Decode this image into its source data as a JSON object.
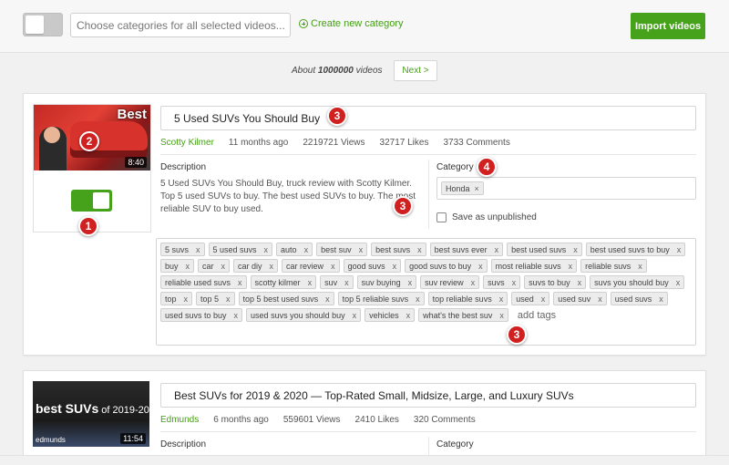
{
  "topbar": {
    "categories_placeholder": "Choose categories for all selected videos...",
    "create_category_label": "Create new category",
    "import_label": "Import videos"
  },
  "pagination": {
    "about_prefix": "About",
    "count": "1000000",
    "about_suffix": "videos",
    "next_label": "Next >"
  },
  "videos": [
    {
      "title": "5 Used SUVs You Should Buy",
      "channel": "Scotty Kilmer",
      "age": "11 months ago",
      "views": "2219721 Views",
      "likes": "32717 Likes",
      "comments": "3733 Comments",
      "thumb_text": "Best",
      "duration": "8:40",
      "description_label": "Description",
      "description": "5 Used SUVs You Should Buy, truck review with Scotty Kilmer. Top 5 used SUVs to buy. The best used SUVs to buy. The most reliable SUV to buy used.",
      "category_label": "Category",
      "category_chip": "Honda",
      "unpublished_label": "Save as unpublished",
      "add_tags_label": "add tags",
      "tags": [
        "5 suvs",
        "5 used suvs",
        "auto",
        "best suv",
        "best suvs",
        "best suvs ever",
        "best used suvs",
        "best used suvs to buy",
        "buy",
        "car",
        "car diy",
        "car review",
        "good suvs",
        "good suvs to buy",
        "most reliable suvs",
        "reliable suvs",
        "reliable used suvs",
        "scotty kilmer",
        "suv",
        "suv buying",
        "suv review",
        "suvs",
        "suvs to buy",
        "suvs you should buy",
        "top",
        "top 5",
        "top 5 best used suvs",
        "top 5 reliable suvs",
        "top reliable suvs",
        "used",
        "used suv",
        "used suvs",
        "used suvs to buy",
        "used suvs you should buy",
        "vehicles",
        "what's the best suv"
      ]
    },
    {
      "title": "Best SUVs for 2019 & 2020 — Top-Rated Small, Midsize, Large, and Luxury SUVs",
      "channel": "Edmunds",
      "age": "6 months ago",
      "views": "559601 Views",
      "likes": "2410 Likes",
      "comments": "320 Comments",
      "thumb_text_main": "best SUVs",
      "thumb_text_small": " of 2019-20",
      "thumb_brand": "edmunds",
      "duration": "11:54",
      "description_label": "Description",
      "category_label": "Category"
    }
  ],
  "markers": {
    "m1": "1",
    "m2": "2",
    "m3": "3",
    "m4": "4"
  },
  "colors": {
    "accent_green": "#46a21a",
    "marker_red": "#d0201f"
  }
}
